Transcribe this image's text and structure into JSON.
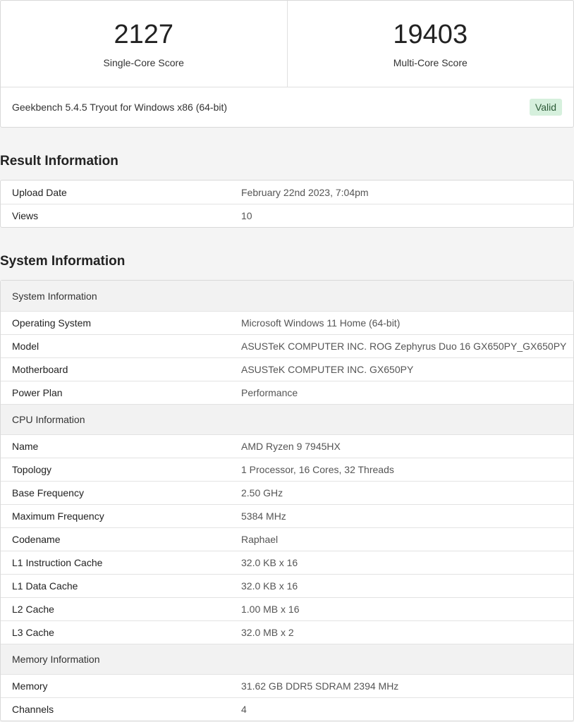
{
  "scores": {
    "single": {
      "value": "2127",
      "label": "Single-Core Score"
    },
    "multi": {
      "value": "19403",
      "label": "Multi-Core Score"
    }
  },
  "version": {
    "text": "Geekbench 5.4.5 Tryout for Windows x86 (64-bit)",
    "badge": "Valid"
  },
  "result_info": {
    "title": "Result Information",
    "rows": [
      {
        "key": "Upload Date",
        "value": "February 22nd 2023, 7:04pm"
      },
      {
        "key": "Views",
        "value": "10"
      }
    ]
  },
  "system_info": {
    "title": "System Information",
    "groups": [
      {
        "header": "System Information",
        "rows": [
          {
            "key": "Operating System",
            "value": "Microsoft Windows 11 Home (64-bit)"
          },
          {
            "key": "Model",
            "value": "ASUSTeK COMPUTER INC. ROG Zephyrus Duo 16 GX650PY_GX650PY"
          },
          {
            "key": "Motherboard",
            "value": "ASUSTeK COMPUTER INC. GX650PY"
          },
          {
            "key": "Power Plan",
            "value": "Performance"
          }
        ]
      },
      {
        "header": "CPU Information",
        "rows": [
          {
            "key": "Name",
            "value": "AMD Ryzen 9 7945HX"
          },
          {
            "key": "Topology",
            "value": "1 Processor, 16 Cores, 32 Threads"
          },
          {
            "key": "Base Frequency",
            "value": "2.50 GHz"
          },
          {
            "key": "Maximum Frequency",
            "value": "5384 MHz"
          },
          {
            "key": "Codename",
            "value": "Raphael"
          },
          {
            "key": "L1 Instruction Cache",
            "value": "32.0 KB x 16"
          },
          {
            "key": "L1 Data Cache",
            "value": "32.0 KB x 16"
          },
          {
            "key": "L2 Cache",
            "value": "1.00 MB x 16"
          },
          {
            "key": "L3 Cache",
            "value": "32.0 MB x 2"
          }
        ]
      },
      {
        "header": "Memory Information",
        "rows": [
          {
            "key": "Memory",
            "value": "31.62 GB DDR5 SDRAM 2394 MHz"
          },
          {
            "key": "Channels",
            "value": "4"
          }
        ]
      }
    ]
  }
}
